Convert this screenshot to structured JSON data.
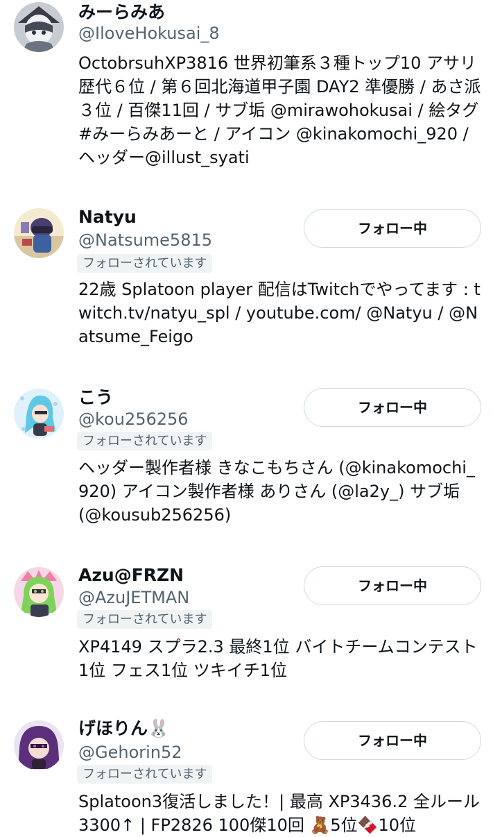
{
  "users": [
    {
      "name": "みーらみあ",
      "handle": "@IloveHokusai_8",
      "bio": "OctobrsuhXP3816 世界初筆系３種トップ10 アサリ歴代６位 / 第６回北海道甲子園 DAY2 準優勝 / あさ派３位 / 百傑11回 / サブ垢 @mirawohokusai / 絵タグ #みーらみあーと / アイコン @kinakomochi_920 / ヘッダー@illust_syati",
      "avatar_icon": "avatar-image"
    },
    {
      "name": "Natyu",
      "handle": "@Natsume5815",
      "follows_you": "フォローされています",
      "button": "フォロー中",
      "bio": "22歳 Splatoon player 配信はTwitchでやってます : twitch.tv/natyu_spl / youtube.com/ @Natyu / @Natsume_Feigo",
      "avatar_icon": "avatar-image"
    },
    {
      "name": "こう",
      "handle": "@kou256256",
      "follows_you": "フォローされています",
      "button": "フォロー中",
      "bio": "ヘッダー製作者様 きなこもちさん (@kinakomochi_920) アイコン製作者様 ありさん (@la2y_) サブ垢 (@kousub256256)",
      "avatar_icon": "avatar-image"
    },
    {
      "name": "Azu@FRZN",
      "handle": "@AzuJETMAN",
      "follows_you": "フォローされています",
      "button": "フォロー中",
      "bio": "XP4149 スプラ2.3 最終1位 バイトチームコンテスト1位 フェス1位 ツキイチ1位",
      "avatar_icon": "avatar-image"
    },
    {
      "name": "げほりん🐰",
      "handle": "@Gehorin52",
      "follows_you": "フォローされています",
      "button": "フォロー中",
      "bio": "Splatoon3復活しました！| 最高 XP3436.2 全ルール3300↑ | FP2826 100傑10回 🧸5位🍫10位",
      "avatar_icon": "avatar-image"
    }
  ],
  "colors": {
    "text_primary": "#0f1419",
    "text_secondary": "#536471",
    "badge_bg": "#eff3f4",
    "button_border": "#cfd9de"
  }
}
